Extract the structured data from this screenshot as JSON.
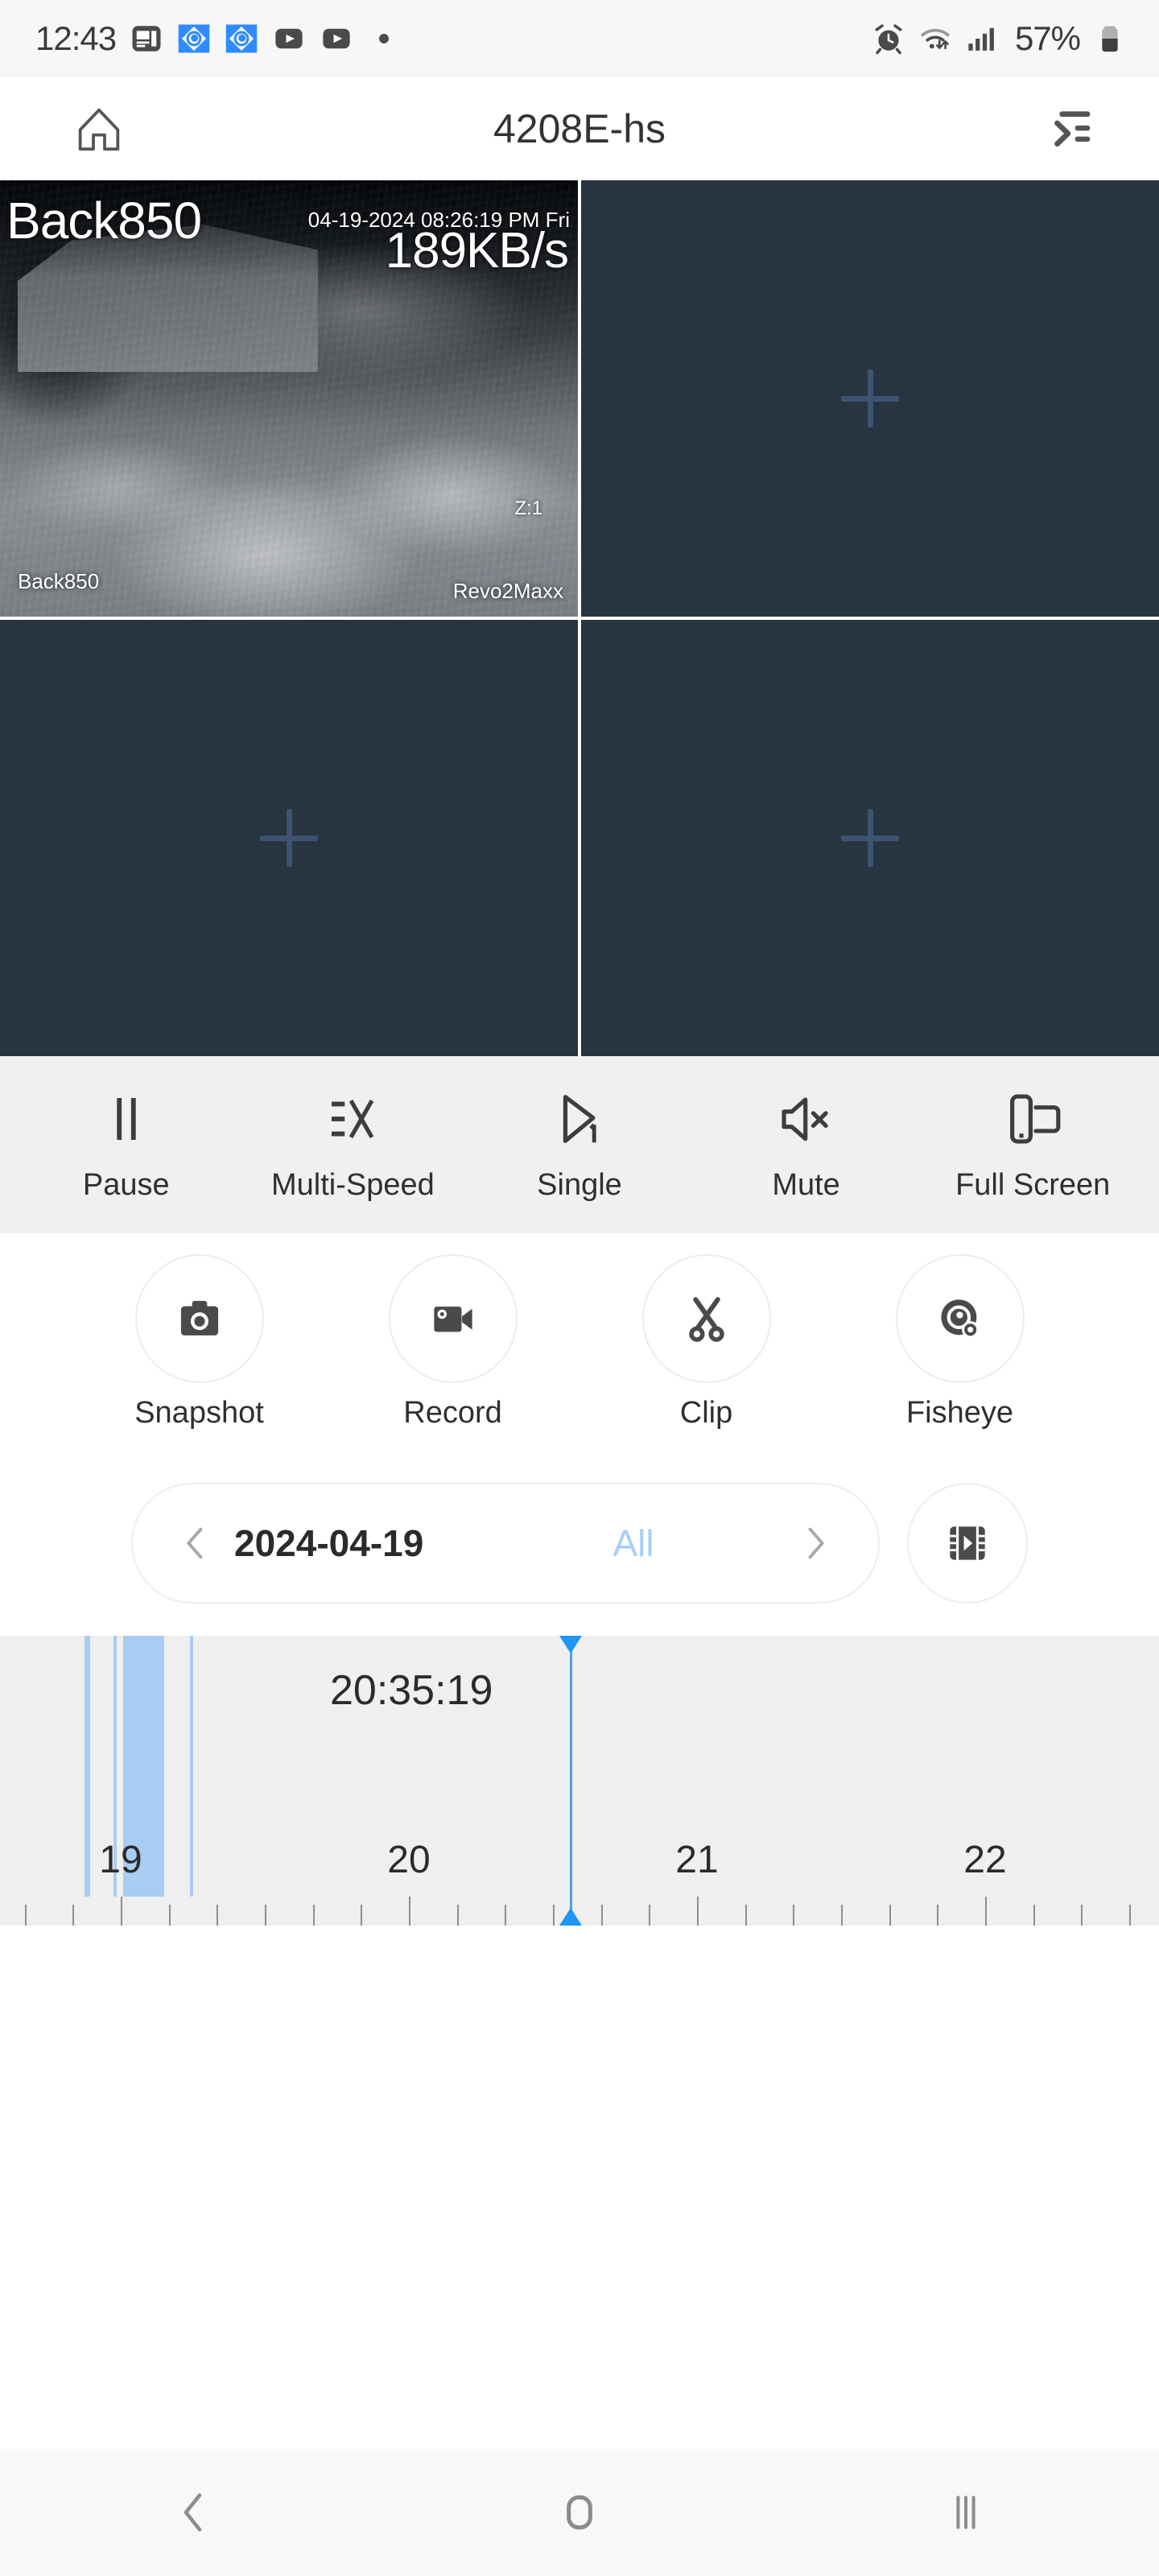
{
  "status_bar": {
    "time": "12:43",
    "battery_percent": "57%",
    "left_icons": [
      "news-icon",
      "eye-app-icon",
      "eye-app-icon",
      "youtube-icon",
      "youtube-icon",
      "dot-icon"
    ],
    "right_icons": [
      "alarm-icon",
      "wifi-icon",
      "signal-icon",
      "battery-icon"
    ]
  },
  "app_bar": {
    "title": "4208E-hs",
    "home_icon": "home-icon",
    "menu_icon": "channel-list-icon"
  },
  "video_grid": {
    "tiles": [
      {
        "state": "live",
        "selected": true,
        "overlay_big_name": "Back850",
        "overlay_timestamp": "04-19-2024 08:26:19 PM Fri",
        "overlay_bitrate": "189KB/s",
        "overlay_zoom": "Z:1",
        "overlay_name": "Back850",
        "overlay_brand": "Revo2Maxx"
      },
      {
        "state": "empty",
        "selected": false,
        "add_icon": "plus-icon"
      },
      {
        "state": "empty",
        "selected": false,
        "add_icon": "plus-icon"
      },
      {
        "state": "empty",
        "selected": false,
        "add_icon": "plus-icon"
      }
    ],
    "selection_color": "#2196f3",
    "empty_tile_color": "#283440",
    "plus_color": "#3c5371"
  },
  "playback_controls": [
    {
      "label": "Pause",
      "icon": "pause-icon"
    },
    {
      "label": "Multi-Speed",
      "icon": "multi-speed-icon"
    },
    {
      "label": "Single",
      "icon": "single-play-icon"
    },
    {
      "label": "Mute",
      "icon": "mute-icon"
    },
    {
      "label": "Full Screen",
      "icon": "full-screen-icon"
    }
  ],
  "action_buttons": [
    {
      "label": "Snapshot",
      "icon": "camera-icon"
    },
    {
      "label": "Record",
      "icon": "video-camera-icon"
    },
    {
      "label": "Clip",
      "icon": "scissors-icon"
    },
    {
      "label": "Fisheye",
      "icon": "fisheye-icon"
    }
  ],
  "date_bar": {
    "prev_icon": "chevron-left-icon",
    "date": "2024-04-19",
    "filter": "All",
    "next_icon": "chevron-right-icon",
    "film_icon": "film-play-icon",
    "filter_color": "#a9cdf5"
  },
  "timeline": {
    "current_time": "20:35:19",
    "hour_labels": [
      "19",
      "20",
      "21",
      "22"
    ],
    "playhead_color": "#2196f3",
    "segment_color": "#a8cdf2",
    "recording_segments": [
      {
        "start_pct": 7.3,
        "width_pct": 0.45
      },
      {
        "start_pct": 9.8,
        "width_pct": 0.3
      },
      {
        "start_pct": 10.6,
        "width_pct": 3.6
      },
      {
        "start_pct": 11.2,
        "width_pct": 0.18
      },
      {
        "start_pct": 11.9,
        "width_pct": 0.18
      },
      {
        "start_pct": 16.4,
        "width_pct": 0.3
      }
    ],
    "playhead_pct": 49.2,
    "time_label_pct": 35.5
  },
  "nav_bar": {
    "back_icon": "back-icon",
    "home_icon": "home-square-icon",
    "recents_icon": "recents-icon"
  }
}
